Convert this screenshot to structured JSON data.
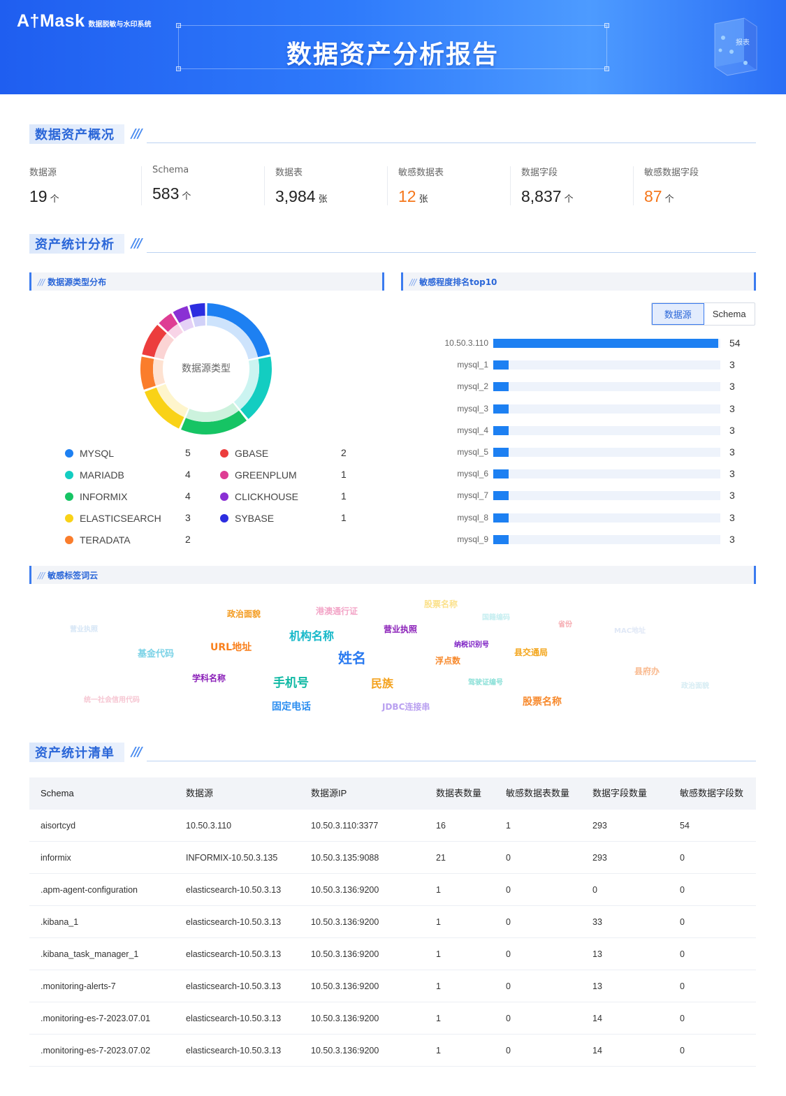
{
  "header": {
    "logo_mark": "A†Mask",
    "logo_sub": "数据脱敏与水印系统",
    "title": "数据资产分析报告",
    "illus_text": "报表"
  },
  "sections": {
    "overview": "数据资产概况",
    "analysis": "资产统计分析",
    "list": "资产统计清单",
    "slashes": "///"
  },
  "stats": [
    {
      "label": "数据源",
      "value": "19",
      "unit": "个"
    },
    {
      "label": "Schema",
      "value": "583",
      "unit": "个"
    },
    {
      "label": "数据表",
      "value": "3,984",
      "unit": "张"
    },
    {
      "label": "敏感数据表",
      "value": "12",
      "unit": "张"
    },
    {
      "label": "数据字段",
      "value": "8,837",
      "unit": "个"
    },
    {
      "label": "敏感数据字段",
      "value": "87",
      "unit": "个"
    }
  ],
  "panels": {
    "datasource_type": "数据源类型分布",
    "sensitivity_top10": "敏感程度排名top10",
    "tag_cloud": "敏感标签词云",
    "slash": "///"
  },
  "donut": {
    "center_label": "数据源类型",
    "items": [
      {
        "name": "MYSQL",
        "count": "5",
        "color": "#1d80f2"
      },
      {
        "name": "MARIADB",
        "count": "4",
        "color": "#13cdc1"
      },
      {
        "name": "INFORMIX",
        "count": "4",
        "color": "#16c464"
      },
      {
        "name": "ELASTICSEARCH",
        "count": "3",
        "color": "#f9d217"
      },
      {
        "name": "TERADATA",
        "count": "2",
        "color": "#fa7d2c"
      },
      {
        "name": "GBASE",
        "count": "2",
        "color": "#ec3d3d"
      },
      {
        "name": "GREENPLUM",
        "count": "1",
        "color": "#de3d94"
      },
      {
        "name": "CLICKHOUSE",
        "count": "1",
        "color": "#8a30d4"
      },
      {
        "name": "SYBASE",
        "count": "1",
        "color": "#2c2de0"
      }
    ]
  },
  "ranking": {
    "toggle": [
      "数据源",
      "Schema"
    ],
    "max": 54,
    "items": [
      {
        "label": "10.50.3.110",
        "value": 54
      },
      {
        "label": "mysql_1",
        "value": 3
      },
      {
        "label": "mysql_2",
        "value": 3
      },
      {
        "label": "mysql_3",
        "value": 3
      },
      {
        "label": "mysql_4",
        "value": 3
      },
      {
        "label": "mysql_5",
        "value": 3
      },
      {
        "label": "mysql_6",
        "value": 3
      },
      {
        "label": "mysql_7",
        "value": 3
      },
      {
        "label": "mysql_8",
        "value": 3
      },
      {
        "label": "mysql_9",
        "value": 3
      }
    ]
  },
  "word_cloud": [
    {
      "text": "营业执照",
      "color": "#d6e6f6"
    },
    {
      "text": "政治面貌",
      "color": "#f39a1d"
    },
    {
      "text": "港澳通行证",
      "color": "#f3a6c8"
    },
    {
      "text": "股票名称",
      "color": "#fbe18c"
    },
    {
      "text": "国籍编码",
      "color": "#c6eef0"
    },
    {
      "text": "省份",
      "color": "#f6aab0"
    },
    {
      "text": "MAC地址",
      "color": "#e0e8f6"
    },
    {
      "text": "基金代码",
      "color": "#7ad2e6"
    },
    {
      "text": "URL地址",
      "color": "#f9801d"
    },
    {
      "text": "机构名称",
      "color": "#17b8c9"
    },
    {
      "text": "营业执照",
      "color": "#8a1fb8"
    },
    {
      "text": "纳税识别号",
      "color": "#7c1fc4"
    },
    {
      "text": "县交通局",
      "color": "#f3a51b"
    },
    {
      "text": "姓名",
      "color": "#2a7af0"
    },
    {
      "text": "浮点数",
      "color": "#f7892c"
    },
    {
      "text": "县府办",
      "color": "#f9b98e"
    },
    {
      "text": "学科名称",
      "color": "#8a1fb8"
    },
    {
      "text": "手机号",
      "color": "#10b9a4"
    },
    {
      "text": "民族",
      "color": "#f4a21d"
    },
    {
      "text": "驾驶证编号",
      "color": "#8be0d8"
    },
    {
      "text": "政治面貌",
      "color": "#d6ecf3"
    },
    {
      "text": "统一社会信用代码",
      "color": "#f6c6d2"
    },
    {
      "text": "固定电话",
      "color": "#2c8ef0"
    },
    {
      "text": "JDBC连接串",
      "color": "#b9a0f0"
    },
    {
      "text": "股票名称",
      "color": "#f7892c"
    }
  ],
  "table": {
    "headers": [
      "Schema",
      "数据源",
      "数据源IP",
      "数据表数量",
      "敏感数据表数量",
      "数据字段数量",
      "敏感数据字段数"
    ],
    "rows": [
      [
        "aisortcyd",
        "10.50.3.110",
        "10.50.3.110:3377",
        "16",
        "1",
        "293",
        "54"
      ],
      [
        "informix",
        "INFORMIX-10.50.3.135",
        "10.50.3.135:9088",
        "21",
        "0",
        "293",
        "0"
      ],
      [
        ".apm-agent-configuration",
        "elasticsearch-10.50.3.13",
        "10.50.3.136:9200",
        "1",
        "0",
        "0",
        "0"
      ],
      [
        ".kibana_1",
        "elasticsearch-10.50.3.13",
        "10.50.3.136:9200",
        "1",
        "0",
        "33",
        "0"
      ],
      [
        ".kibana_task_manager_1",
        "elasticsearch-10.50.3.13",
        "10.50.3.136:9200",
        "1",
        "0",
        "13",
        "0"
      ],
      [
        ".monitoring-alerts-7",
        "elasticsearch-10.50.3.13",
        "10.50.3.136:9200",
        "1",
        "0",
        "13",
        "0"
      ],
      [
        ".monitoring-es-7-2023.07.01",
        "elasticsearch-10.50.3.13",
        "10.50.3.136:9200",
        "1",
        "0",
        "14",
        "0"
      ],
      [
        ".monitoring-es-7-2023.07.02",
        "elasticsearch-10.50.3.13",
        "10.50.3.136:9200",
        "1",
        "0",
        "14",
        "0"
      ]
    ]
  }
}
